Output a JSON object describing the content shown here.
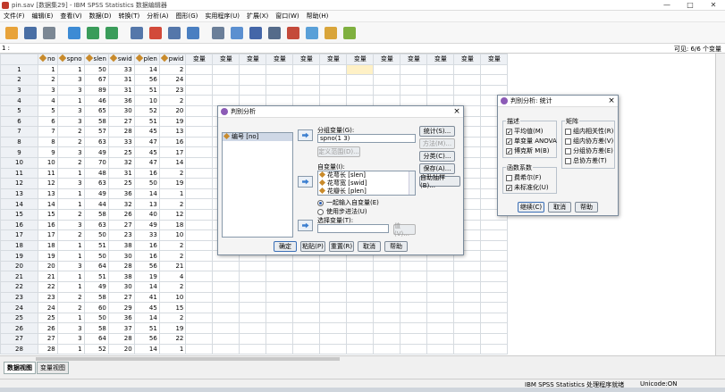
{
  "window": {
    "title": "pin.sav [数据集29] - IBM SPSS Statistics 数据编辑器",
    "controls": [
      "—",
      "□",
      "✕"
    ]
  },
  "menu": [
    "文件(F)",
    "编辑(E)",
    "查看(V)",
    "数据(D)",
    "转换(T)",
    "分析(A)",
    "图形(G)",
    "实用程序(U)",
    "扩展(X)",
    "窗口(W)",
    "帮助(H)"
  ],
  "toolbar": {
    "icons": [
      "open-icon",
      "save-icon",
      "print-icon",
      "dialog-recall-icon",
      "undo-icon",
      "redo-icon",
      "goto-case-icon",
      "goto-variable-icon",
      "variables-icon",
      "run-descriptives-icon",
      "find-icon",
      "insert-cases-icon",
      "insert-variable-icon",
      "split-file-icon",
      "weight-cases-icon",
      "select-cases-icon",
      "value-labels-icon",
      "use-sets-icon"
    ],
    "colors": [
      "#e8a33a",
      "#4a6fa5",
      "#7b8794",
      "#3d8bd4",
      "#3a9c5a",
      "#3a9c5a",
      "#5577aa",
      "#d24a3a",
      "#5577aa",
      "#4a7fc1",
      "#6b7f99",
      "#5b8fd0",
      "#4466a8",
      "#556b8a",
      "#c44a3a",
      "#5aa0d8",
      "#d9a53a",
      "#7fb03f"
    ]
  },
  "cell": {
    "ref": "1 :",
    "visible": "可见: 6/6 个变量"
  },
  "grid": {
    "columns": [
      "no",
      "spno",
      "slen",
      "swid",
      "plen",
      "pwid"
    ],
    "extra_label": "变量",
    "extra_count": 12,
    "rows": [
      [
        1,
        1,
        50,
        33,
        14,
        2
      ],
      [
        2,
        3,
        67,
        31,
        56,
        24
      ],
      [
        3,
        3,
        89,
        31,
        51,
        23
      ],
      [
        4,
        1,
        46,
        36,
        10,
        2
      ],
      [
        5,
        3,
        65,
        30,
        52,
        20
      ],
      [
        6,
        3,
        58,
        27,
        51,
        19
      ],
      [
        7,
        2,
        57,
        28,
        45,
        13
      ],
      [
        8,
        2,
        63,
        33,
        47,
        16
      ],
      [
        9,
        3,
        49,
        25,
        45,
        17
      ],
      [
        10,
        2,
        70,
        32,
        47,
        14
      ],
      [
        11,
        1,
        48,
        31,
        16,
        2
      ],
      [
        12,
        3,
        63,
        25,
        50,
        19
      ],
      [
        13,
        1,
        49,
        36,
        14,
        1
      ],
      [
        14,
        1,
        44,
        32,
        13,
        2
      ],
      [
        15,
        2,
        58,
        26,
        40,
        12
      ],
      [
        16,
        3,
        63,
        27,
        49,
        18
      ],
      [
        17,
        2,
        50,
        23,
        33,
        10
      ],
      [
        18,
        1,
        51,
        38,
        16,
        2
      ],
      [
        19,
        1,
        50,
        30,
        16,
        2
      ],
      [
        20,
        3,
        64,
        28,
        56,
        21
      ],
      [
        21,
        1,
        51,
        38,
        19,
        4
      ],
      [
        22,
        1,
        49,
        30,
        14,
        2
      ],
      [
        23,
        2,
        58,
        27,
        41,
        10
      ],
      [
        24,
        2,
        60,
        29,
        45,
        15
      ],
      [
        25,
        1,
        50,
        36,
        14,
        2
      ],
      [
        26,
        3,
        58,
        37,
        51,
        19
      ],
      [
        27,
        3,
        64,
        28,
        56,
        22
      ],
      [
        28,
        1,
        52,
        20,
        14,
        1
      ]
    ]
  },
  "tabs": [
    "数据视图",
    "变量视图"
  ],
  "status": {
    "processor": "IBM SPSS Statistics 处理程序就绪",
    "unicode": "Unicode:ON"
  },
  "discriminant_dialog": {
    "title": "判别分析",
    "source_list": [
      "编号 [no]"
    ],
    "grouping_label": "分组变量(G):",
    "grouping_value": "spno(1 3)",
    "define_range": "定义范围(D)...",
    "independents_label": "自变量(I):",
    "independents": [
      "花萼长 [slen]",
      "花萼宽 [swid]",
      "花瓣长 [plen]"
    ],
    "enter_together": "一起输入自变量(E)",
    "use_stepwise": "使用步进法(U)",
    "selection_label": "选择变量(T):",
    "value_button": "值(V)...",
    "side_buttons": [
      "统计(S)...",
      "方法(M)...",
      "分类(C)...",
      "保存(A)...",
      "自助抽样(B)..."
    ],
    "bottom_buttons": [
      "确定",
      "粘贴(P)",
      "重置(R)",
      "取消",
      "帮助"
    ]
  },
  "stats_dialog": {
    "title": "判别分析: 统计",
    "descriptives_label": "描述",
    "descriptives": [
      {
        "label": "平均值(M)",
        "checked": true
      },
      {
        "label": "单变量 ANOVA",
        "checked": true
      },
      {
        "label": "博克斯 M(B)",
        "checked": true
      }
    ],
    "function_label": "函数系数",
    "functions": [
      {
        "label": "费希尔(F)",
        "checked": false
      },
      {
        "label": "未标准化(U)",
        "checked": true
      }
    ],
    "matrices_label": "矩阵",
    "matrices": [
      {
        "label": "组内相关性(R)",
        "checked": false
      },
      {
        "label": "组内协方差(V)",
        "checked": false
      },
      {
        "label": "分组协方差(E)",
        "checked": false
      },
      {
        "label": "总协方差(T)",
        "checked": false
      }
    ],
    "buttons": [
      "继续(C)",
      "取消",
      "帮助"
    ]
  }
}
